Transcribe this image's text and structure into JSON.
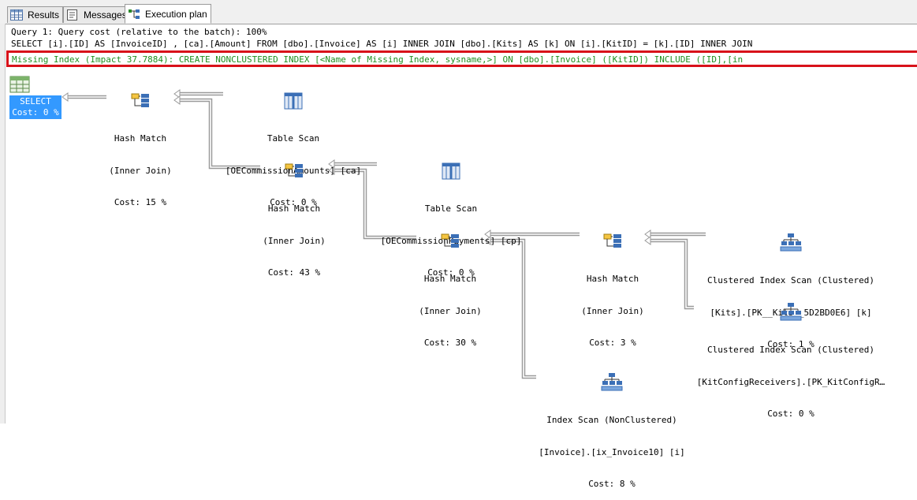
{
  "tabs": [
    {
      "label": "Results",
      "icon": "grid-icon"
    },
    {
      "label": "Messages",
      "icon": "messages-icon"
    },
    {
      "label": "Execution plan",
      "icon": "execution-plan-icon",
      "active": true
    }
  ],
  "query": {
    "cost_line": "Query 1: Query cost (relative to the batch): 100%",
    "sql_line": "SELECT [i].[ID] AS [InvoiceID] , [ca].[Amount] FROM [dbo].[Invoice] AS [i] INNER JOIN [dbo].[Kits] AS [k] ON [i].[KitID] = [k].[ID] INNER JOIN",
    "missing_index": "Missing Index (Impact 37.7884): CREATE NONCLUSTERED INDEX [<Name of Missing Index, sysname,>] ON [dbo].[Invoice] ([KitID]) INCLUDE ([ID],[in"
  },
  "colors": {
    "highlight_border": "#d8121a",
    "missing_index_text": "#1e8f1e",
    "selected_node": "#3399ff"
  },
  "nodes": {
    "select": {
      "line1": "SELECT",
      "line2": "Cost: 0 %",
      "icon": "select-result-icon"
    },
    "hash1": {
      "line1": "Hash Match",
      "line2": "(Inner Join)",
      "line3": "Cost: 15 %",
      "icon": "hash-match-icon"
    },
    "tscan_ca": {
      "line1": "Table Scan",
      "line2": "[OECommissionAmounts] [ca]",
      "line3": "Cost: 0 %",
      "icon": "table-scan-icon"
    },
    "hash2": {
      "line1": "Hash Match",
      "line2": "(Inner Join)",
      "line3": "Cost: 43 %",
      "icon": "hash-match-icon"
    },
    "tscan_cp": {
      "line1": "Table Scan",
      "line2": "[OECommissionPayments] [cp]",
      "line3": "Cost: 0 %",
      "icon": "table-scan-icon"
    },
    "hash3": {
      "line1": "Hash Match",
      "line2": "(Inner Join)",
      "line3": "Cost: 30 %",
      "icon": "hash-match-icon"
    },
    "hash4": {
      "line1": "Hash Match",
      "line2": "(Inner Join)",
      "line3": "Cost: 3 %",
      "icon": "hash-match-icon"
    },
    "ciscan_kits": {
      "line1": "Clustered Index Scan (Clustered)",
      "line2": "[Kits].[PK__Kits__5D2BD0E6] [k]",
      "line3": "Cost: 1 %",
      "icon": "clustered-index-scan-icon"
    },
    "ciscan_kcr": {
      "line1": "Clustered Index Scan (Clustered)",
      "line2": "[KitConfigReceivers].[PK_KitConfigR…",
      "line3": "Cost: 0 %",
      "icon": "clustered-index-scan-icon"
    },
    "iscan_inv": {
      "line1": "Index Scan (NonClustered)",
      "line2": "[Invoice].[ix_Invoice10] [i]",
      "line3": "Cost: 8 %",
      "icon": "index-scan-icon"
    }
  }
}
